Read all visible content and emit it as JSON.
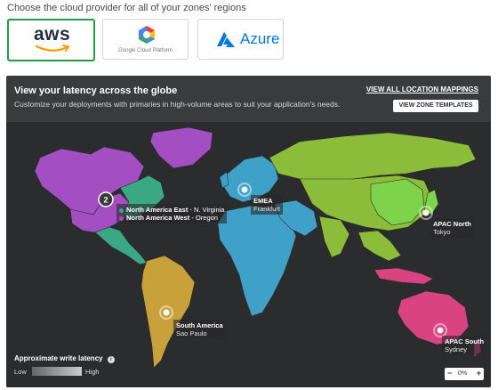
{
  "heading": "Choose the cloud provider for all of your zones' regions",
  "providers": {
    "aws": {
      "label": "aws"
    },
    "gcp": {
      "label": "Google Cloud Platform"
    },
    "azure": {
      "label": "Azure"
    }
  },
  "panel": {
    "title": "View your latency across the globe",
    "subtitle": "Customize your deployments with primaries in high-volume areas to suit your application's needs.",
    "view_all": "VIEW ALL LOCATION MAPPINGS",
    "zone_templates": "VIEW ZONE TEMPLATES"
  },
  "map": {
    "cluster_count": "2",
    "regions": {
      "na_east_name": "North America East",
      "na_east_loc": " - N. Virginia",
      "na_west_name": "North America West",
      "na_west_loc": " - Oregon",
      "emea_name": "EMEA",
      "emea_loc": "Frankfurt",
      "apac_north_name": "APAC North",
      "apac_north_loc": "Tokyo",
      "south_america_name": "South America",
      "south_america_loc": "Sao Paulo",
      "apac_south_name": "APAC South",
      "apac_south_loc": "Sydney"
    },
    "colors": {
      "north_america": "#a34fc2",
      "north_america_east": "#3aa883",
      "europe_africa": "#3fa1c7",
      "asia": "#8bbd3a",
      "south_america": "#c9a13a",
      "oceania": "#d9437f"
    }
  },
  "legend": {
    "title": "Approximate write latency",
    "low": "Low",
    "high": "High"
  },
  "zoom": {
    "value": "0%",
    "minus": "−",
    "plus": "+"
  }
}
